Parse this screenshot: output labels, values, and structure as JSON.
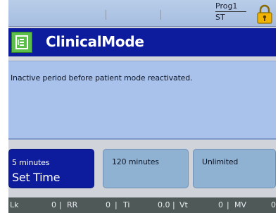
{
  "status": {
    "prog_label": "Prog1",
    "prog_sub": "ST",
    "lock_icon": "padlock-icon"
  },
  "header": {
    "icon": "clinical-mode-icon",
    "title": "ClinicalMode"
  },
  "info": {
    "text": "Inactive period before patient mode reactivated."
  },
  "options": [
    {
      "label": "5 minutes",
      "sub": "Set Time",
      "selected": true
    },
    {
      "label": "120 minutes",
      "selected": false
    },
    {
      "label": "Unlimited",
      "selected": false
    }
  ],
  "footer": {
    "lk_label": "Lk",
    "lk_value": "0",
    "rr_label": "RR",
    "rr_value": "0",
    "ti_label": "Ti",
    "ti_value": "0.0",
    "vt_label": "Vt",
    "vt_value": "0",
    "mv_label": "MV",
    "mv_value": "0"
  },
  "colors": {
    "header_bg": "#0d1c9c",
    "status_bg": "#b2c8e6",
    "panel_bg": "#a8c2ec",
    "option_bg": "#8fb2d3",
    "footer_bg": "#4f5a58",
    "icon_green": "#5bbf4a",
    "lock_gold": "#f0b400"
  }
}
